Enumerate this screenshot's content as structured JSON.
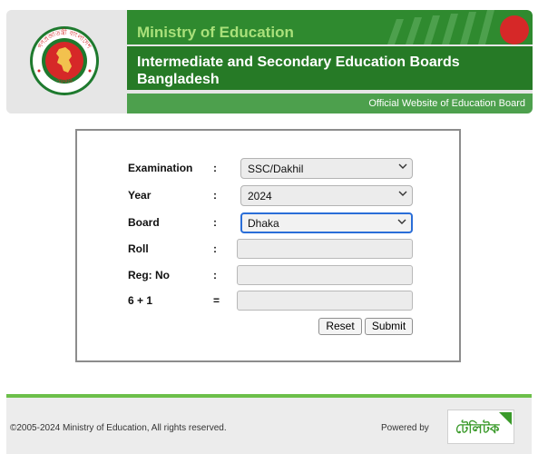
{
  "header": {
    "ministry": "Ministry of Education",
    "boards_title": "Intermediate and Secondary Education Boards Bangladesh",
    "official": "Official Website of Education Board",
    "logo_text_top": "গণপ্রজাতন্ত্রী বাংলাদেশ",
    "logo_text_bottom": "সরকার"
  },
  "form": {
    "rows": [
      {
        "label": "Examination",
        "sep": ":",
        "value": "SSC/Dakhil"
      },
      {
        "label": "Year",
        "sep": ":",
        "value": "2024"
      },
      {
        "label": "Board",
        "sep": ":",
        "value": "Dhaka"
      },
      {
        "label": "Roll",
        "sep": ":",
        "value": ""
      },
      {
        "label": "Reg: No",
        "sep": ":",
        "value": ""
      },
      {
        "label": "6 + 1",
        "sep": "=",
        "value": ""
      }
    ],
    "reset_label": "Reset",
    "submit_label": "Submit"
  },
  "footer": {
    "copyright": "©2005-2024 Ministry of Education, All rights reserved.",
    "powered_by": "Powered by",
    "brand_logo": "টেলিটক"
  },
  "colors": {
    "header_green_dark": "#267a26",
    "header_green": "#2f8a2f",
    "header_green_light": "#4da04d",
    "ministry_text": "#a9e07a",
    "focus_blue": "#2a6ed8",
    "footer_accent": "#6cbf4a"
  }
}
